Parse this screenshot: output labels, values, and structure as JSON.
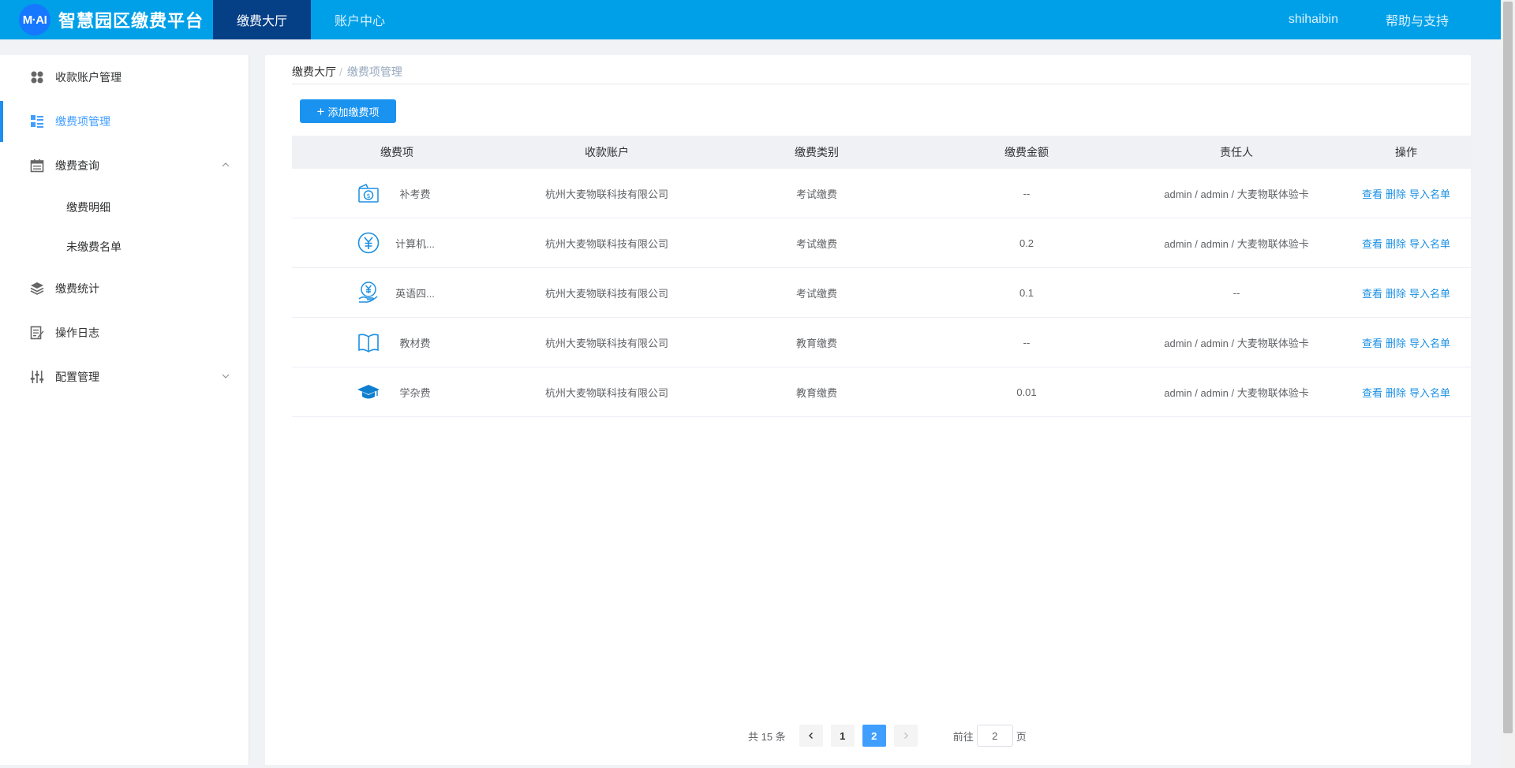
{
  "header": {
    "logo_text": "M·AI",
    "title": "智慧园区缴费平台",
    "tabs": [
      {
        "label": "缴费大厅",
        "active": true
      },
      {
        "label": "账户中心",
        "active": false
      }
    ],
    "username": "shihaibin",
    "help": "帮助与支持",
    "colors": {
      "bar": "#00a0e9",
      "active_tab": "#053f86"
    }
  },
  "sidebar": {
    "items": [
      {
        "label": "收款账户管理",
        "icon": "grid-dots-icon"
      },
      {
        "label": "缴费项管理",
        "icon": "list-icon",
        "active": true
      },
      {
        "label": "缴费查询",
        "icon": "calendar-icon",
        "expanded": true,
        "children": [
          {
            "label": "缴费明细"
          },
          {
            "label": "未缴费名单"
          }
        ]
      },
      {
        "label": "缴费统计",
        "icon": "layers-icon"
      },
      {
        "label": "操作日志",
        "icon": "edit-doc-icon"
      },
      {
        "label": "配置管理",
        "icon": "sliders-icon",
        "expanded": false
      }
    ]
  },
  "breadcrumb": {
    "root": "缴费大厅",
    "sep": "/",
    "current": "缴费项管理"
  },
  "add_button": {
    "label": "添加缴费项",
    "icon": "plus-icon"
  },
  "table": {
    "headers": [
      "缴费项",
      "收款账户",
      "缴费类别",
      "缴费金额",
      "责任人",
      "操作"
    ],
    "rows": [
      {
        "icon": "camera-money-icon",
        "name": "补考费",
        "account": "杭州大麦物联科技有限公司",
        "category": "考试缴费",
        "amount": "--",
        "owner": "admin / admin / 大麦物联体验卡"
      },
      {
        "icon": "yuan-circle-icon",
        "name": "计算机...",
        "account": "杭州大麦物联科技有限公司",
        "category": "考试缴费",
        "amount": "0.2",
        "owner": "admin / admin / 大麦物联体验卡"
      },
      {
        "icon": "yuan-hand-icon",
        "name": "英语四...",
        "account": "杭州大麦物联科技有限公司",
        "category": "考试缴费",
        "amount": "0.1",
        "owner": "--"
      },
      {
        "icon": "book-icon",
        "name": "教材费",
        "account": "杭州大麦物联科技有限公司",
        "category": "教育缴费",
        "amount": "--",
        "owner": "admin / admin / 大麦物联体验卡"
      },
      {
        "icon": "graduation-cap-icon",
        "name": "学杂费",
        "account": "杭州大麦物联科技有限公司",
        "category": "教育缴费",
        "amount": "0.01",
        "owner": "admin / admin / 大麦物联体验卡"
      }
    ],
    "actions": [
      "查看",
      "删除",
      "导入名单"
    ]
  },
  "pagination": {
    "total": "共 15 条",
    "pages": [
      "1",
      "2"
    ],
    "current": "2",
    "goto_prefix": "前往",
    "goto_value": "2",
    "goto_suffix": "页"
  }
}
